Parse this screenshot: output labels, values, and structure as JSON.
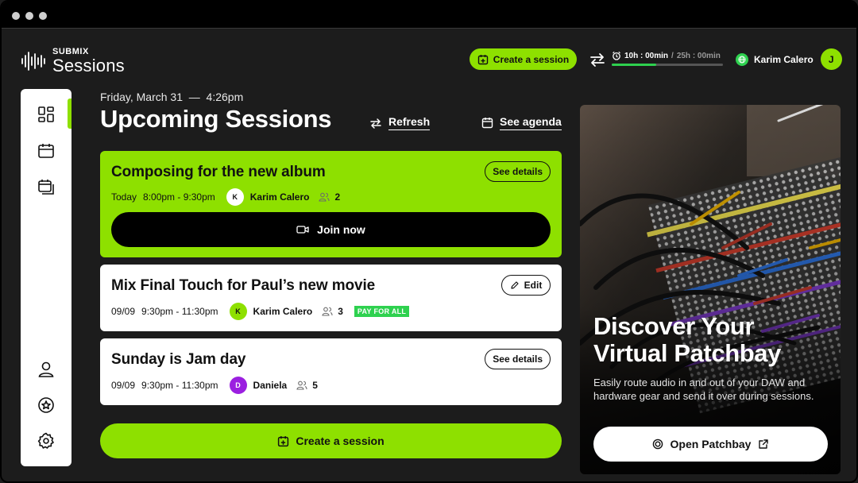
{
  "brand": {
    "small": "SUBMIX",
    "big": "Sessions"
  },
  "header": {
    "create_label": "Create a session",
    "timer_used": "10h : 00min",
    "timer_sep": "/",
    "timer_total": "25h : 00min",
    "timer_progress": 0.4,
    "user_name": "Karim Calero",
    "user_initial": "J"
  },
  "main": {
    "date": "Friday, March 31  —  4:26pm",
    "title": "Upcoming Sessions",
    "refresh_label": "Refresh",
    "agenda_label": "See agenda"
  },
  "sessions": [
    {
      "title": "Composing for the new album",
      "action": "See details",
      "day": "Today",
      "time": "8:00pm - 9:30pm",
      "host_initial": "K",
      "host": "Karim Calero",
      "participants": "2",
      "join_label": "Join now"
    },
    {
      "title": "Mix Final Touch for Paul’s new movie",
      "action": "Edit",
      "day": "09/09",
      "time": "9:30pm - 11:30pm",
      "host_initial": "K",
      "host": "Karim Calero",
      "participants": "3",
      "tag": "PAY FOR ALL"
    },
    {
      "title": "Sunday is Jam day",
      "action": "See details",
      "day": "09/09",
      "time": "9:30pm - 11:30pm",
      "host_initial": "D",
      "host": "Daniela",
      "participants": "5"
    }
  ],
  "create_bottom_label": "Create a session",
  "promo": {
    "title_line1": "Discover Your",
    "title_line2": "Virtual Patchbay",
    "description": "Easily route audio in and out of your DAW and hardware gear and send it over during sessions.",
    "button_label": "Open Patchbay"
  },
  "colors": {
    "accent": "#8ee000",
    "tag_green": "#2ed14f",
    "purple": "#9b1fe0"
  },
  "icons": {
    "sidebar": [
      "dashboard-icon",
      "calendar-icon",
      "sessions-icon",
      "user-icon",
      "star-icon",
      "settings-icon"
    ]
  }
}
